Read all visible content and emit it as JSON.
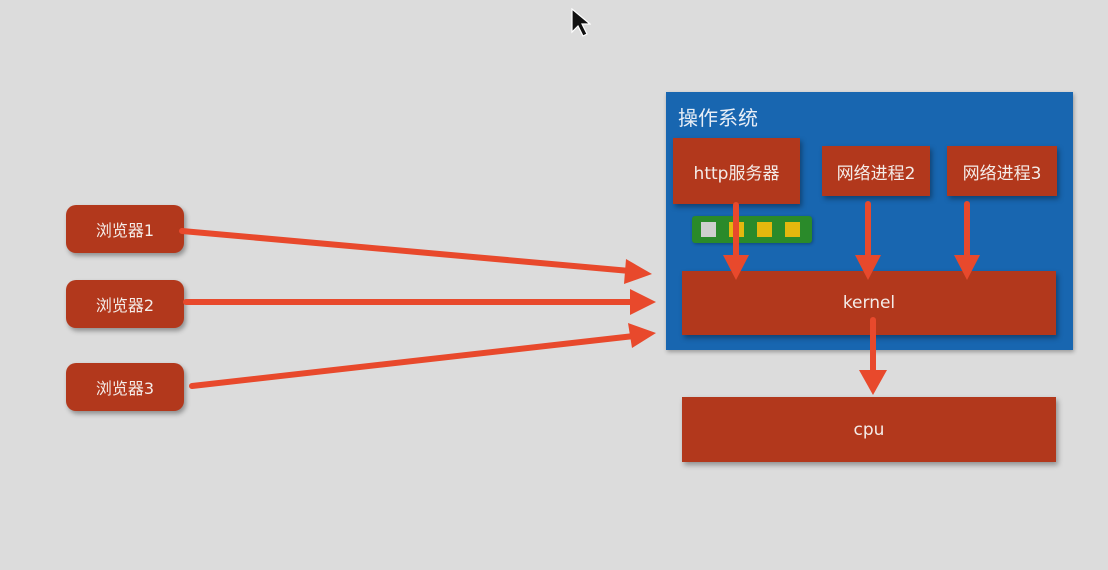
{
  "browsers": [
    {
      "label": "浏览器1"
    },
    {
      "label": "浏览器2"
    },
    {
      "label": "浏览器3"
    }
  ],
  "os": {
    "title": "操作系统",
    "http_server": "http服务器",
    "process2": "网络进程2",
    "process3": "网络进程3",
    "kernel": "kernel"
  },
  "cpu": "cpu",
  "queue": {
    "slots": [
      "gray",
      "yellow",
      "yellow",
      "yellow"
    ]
  },
  "colors": {
    "background": "#dcdcdc",
    "box": "#b2381c",
    "os_panel": "#1866b0",
    "arrow": "#e8492c",
    "queue": "#2a8a2a",
    "slot_yellow": "#e4b80e",
    "slot_gray": "#cfcfcf"
  }
}
